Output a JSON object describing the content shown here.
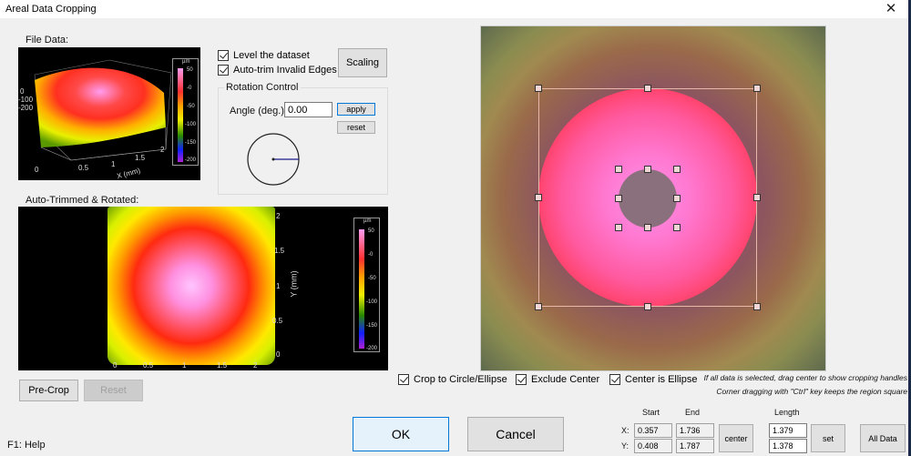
{
  "window": {
    "title": "Areal Data Cropping",
    "close_icon": "close-icon"
  },
  "left": {
    "file_data_label": "File Data:",
    "trimmed_label": "Auto-Trimmed & Rotated:",
    "plot3d": {
      "z_ticks": [
        "0",
        "-100",
        "-200"
      ],
      "x_ticks": [
        "0",
        "0.5",
        "1",
        "1.5",
        "2"
      ],
      "x_label": "X (mm)",
      "colorbar_unit": "µm",
      "colorbar_ticks": [
        "50",
        "-0",
        "-50",
        "-100",
        "-150",
        "-200"
      ]
    },
    "plot2d": {
      "x_ticks": [
        "0",
        "0.5",
        "1",
        "1.5",
        "2"
      ],
      "y_ticks": [
        "2",
        "1.5",
        "1",
        "0.5",
        "0"
      ],
      "y_label": "Y (mm)",
      "colorbar_unit": "µm",
      "colorbar_ticks": [
        "50",
        "-0",
        "-50",
        "-100",
        "-150",
        "-200"
      ]
    },
    "precrop_label": "Pre-Crop",
    "reset_label": "Reset",
    "help_text": "F1: Help"
  },
  "options": {
    "level_dataset": {
      "label": "Level the dataset",
      "checked": true
    },
    "auto_trim": {
      "label": "Auto-trim Invalid Edges",
      "checked": true
    },
    "scaling_label": "Scaling",
    "rotation": {
      "group_label": "Rotation Control",
      "angle_label": "Angle (deg.)",
      "angle_value": "0.00",
      "apply_label": "apply",
      "reset_label": "reset"
    }
  },
  "crop": {
    "crop_circle": {
      "label": "Crop to Circle/Ellipse",
      "checked": true
    },
    "exclude_center": {
      "label": "Exclude Center",
      "checked": true
    },
    "center_ellipse": {
      "label": "Center is Ellipse",
      "checked": true
    },
    "hint1": "If all data is selected, drag center to show cropping handles",
    "hint2": "Corner dragging with \"Ctrl\" key keeps the region square",
    "start_label": "Start",
    "end_label": "End",
    "length_label": "Length",
    "x_label": "X:",
    "y_label": "Y:",
    "x_start": "0.357",
    "x_end": "1.736",
    "y_start": "0.408",
    "y_end": "1.787",
    "x_length": "1.379",
    "y_length": "1.378",
    "center_label": "center",
    "set_label": "set",
    "all_data_label": "All Data"
  },
  "footer": {
    "ok_label": "OK",
    "cancel_label": "Cancel"
  }
}
